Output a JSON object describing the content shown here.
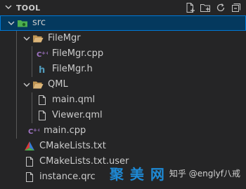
{
  "explorer": {
    "section_title": "TOOL",
    "actions": [
      {
        "name": "new-file-icon"
      },
      {
        "name": "new-folder-icon"
      },
      {
        "name": "refresh-icon"
      },
      {
        "name": "collapse-all-icon"
      }
    ]
  },
  "tree": [
    {
      "label": "src",
      "kind": "folder-src",
      "level": 0,
      "expanded": true,
      "selected": true
    },
    {
      "label": "FileMgr",
      "kind": "folder",
      "level": 1,
      "expanded": true,
      "selected": false
    },
    {
      "label": "FileMgr.cpp",
      "kind": "cpp",
      "level": 2,
      "selected": false
    },
    {
      "label": "FileMgr.h",
      "kind": "h",
      "level": 2,
      "selected": false
    },
    {
      "label": "QML",
      "kind": "folder",
      "level": 1,
      "expanded": true,
      "selected": false
    },
    {
      "label": "main.qml",
      "kind": "file",
      "level": 2,
      "selected": false
    },
    {
      "label": "Viewer.qml",
      "kind": "file",
      "level": 2,
      "selected": false
    },
    {
      "label": "main.cpp",
      "kind": "cpp",
      "level": 1,
      "selected": false
    },
    {
      "label": "CMakeLists.txt",
      "kind": "cmake",
      "level": 0,
      "selected": false
    },
    {
      "label": "CMakeLists.txt.user",
      "kind": "file",
      "level": 0,
      "selected": false
    },
    {
      "label": "instance.qrc",
      "kind": "file",
      "level": 0,
      "selected": false
    }
  ],
  "watermark": {
    "logo": "聚 美 网",
    "text": "知乎 @englyf八戒"
  },
  "colors": {
    "background": "#252526",
    "selection": "#04395e",
    "selection_border": "#0078d4",
    "cpp_icon": "#a074c4",
    "h_icon": "#519aba",
    "folder_icon": "#dcb67a",
    "src_folder_icon": "#4caf50"
  }
}
